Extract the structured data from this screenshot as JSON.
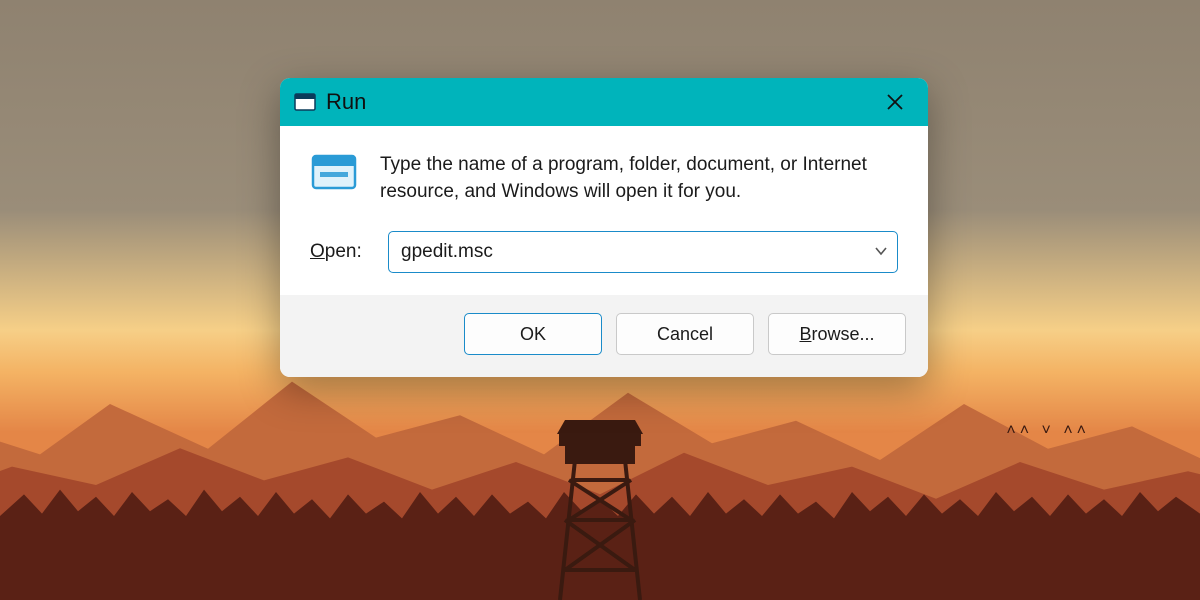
{
  "dialog": {
    "title": "Run",
    "description": "Type the name of a program, folder, document, or Internet resource, and Windows will open it for you.",
    "open_label_prefix": "O",
    "open_label_rest": "pen:",
    "command_value": "gpedit.msc",
    "buttons": {
      "ok": "OK",
      "cancel": "Cancel",
      "browse_prefix": "B",
      "browse_rest": "rowse..."
    }
  },
  "colors": {
    "titlebar": "#00b4bb",
    "accent_border": "#1a8bc9"
  }
}
